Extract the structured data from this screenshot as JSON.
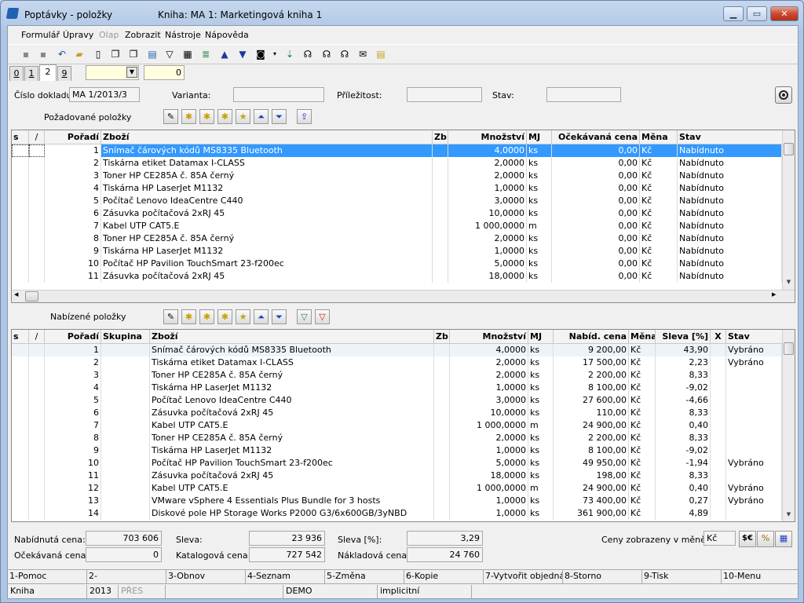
{
  "window": {
    "title": "Poptávky - položky",
    "subtitle": "Kniha: MA 1: Marketingová kniha 1"
  },
  "menu": [
    "Formulář",
    "Úpravy",
    "Olap",
    "Zobrazit",
    "Nástroje",
    "Nápověda"
  ],
  "tabs": [
    "0",
    "1",
    "2",
    "9"
  ],
  "tab_filter": {
    "value": "",
    "counter": "0"
  },
  "header": {
    "cislo_label": "Číslo dokladu:",
    "cislo_value": "MA 1/2013/3",
    "varianta_label": "Varianta:",
    "varianta_value": "",
    "prilezitost_label": "Příležitost:",
    "prilezitost_value": "",
    "stav_label": "Stav:",
    "stav_value": ""
  },
  "requested": {
    "title": "Požadované položky",
    "columns": [
      "s",
      "/",
      "Pořadí",
      "Zboží",
      "Zb",
      "Množství",
      "MJ",
      "Očekávaná cena",
      "Měna",
      "Stav"
    ],
    "rows": [
      {
        "poradi": "1",
        "zbozi": "Snímač čárových kódů MS8335 Bluetooth",
        "mnozstvi": "4,0000",
        "mj": "ks",
        "cena": "0,00",
        "mena": "Kč",
        "stav": "Nabídnuto"
      },
      {
        "poradi": "2",
        "zbozi": "Tiskárna etiket Datamax I-CLASS",
        "mnozstvi": "2,0000",
        "mj": "ks",
        "cena": "0,00",
        "mena": "Kč",
        "stav": "Nabídnuto"
      },
      {
        "poradi": "3",
        "zbozi": "Toner HP CE285A č. 85A černý",
        "mnozstvi": "2,0000",
        "mj": "ks",
        "cena": "0,00",
        "mena": "Kč",
        "stav": "Nabídnuto"
      },
      {
        "poradi": "4",
        "zbozi": "Tiskárna HP LaserJet M1132",
        "mnozstvi": "1,0000",
        "mj": "ks",
        "cena": "0,00",
        "mena": "Kč",
        "stav": "Nabídnuto"
      },
      {
        "poradi": "5",
        "zbozi": "Počítač Lenovo IdeaCentre C440",
        "mnozstvi": "3,0000",
        "mj": "ks",
        "cena": "0,00",
        "mena": "Kč",
        "stav": "Nabídnuto"
      },
      {
        "poradi": "6",
        "zbozi": "Zásuvka počítačová 2xRJ 45",
        "mnozstvi": "10,0000",
        "mj": "ks",
        "cena": "0,00",
        "mena": "Kč",
        "stav": "Nabídnuto"
      },
      {
        "poradi": "7",
        "zbozi": "Kabel UTP CAT5.E",
        "mnozstvi": "1 000,0000",
        "mj": "m",
        "cena": "0,00",
        "mena": "Kč",
        "stav": "Nabídnuto"
      },
      {
        "poradi": "8",
        "zbozi": "Toner HP CE285A č. 85A černý",
        "mnozstvi": "2,0000",
        "mj": "ks",
        "cena": "0,00",
        "mena": "Kč",
        "stav": "Nabídnuto"
      },
      {
        "poradi": "9",
        "zbozi": "Tiskárna HP LaserJet M1132",
        "mnozstvi": "1,0000",
        "mj": "ks",
        "cena": "0,00",
        "mena": "Kč",
        "stav": "Nabídnuto"
      },
      {
        "poradi": "10",
        "zbozi": "Počítač HP Pavilion TouchSmart 23-f200ec",
        "mnozstvi": "5,0000",
        "mj": "ks",
        "cena": "0,00",
        "mena": "Kč",
        "stav": "Nabídnuto"
      },
      {
        "poradi": "11",
        "zbozi": "Zásuvka počítačová 2xRJ 45",
        "mnozstvi": "18,0000",
        "mj": "ks",
        "cena": "0,00",
        "mena": "Kč",
        "stav": "Nabídnuto"
      }
    ]
  },
  "offered": {
    "title": "Nabízené položky",
    "columns": [
      "s",
      "/",
      "Pořadí",
      "Skupina",
      "Zboží",
      "Zb",
      "Množství",
      "MJ",
      "Nabíd. cena",
      "Měna",
      "Sleva [%]",
      "X",
      "Stav"
    ],
    "rows": [
      {
        "poradi": "1",
        "zbozi": "Snímač čárových kódů MS8335 Bluetooth",
        "mnozstvi": "4,0000",
        "mj": "ks",
        "cena": "9 200,00",
        "mena": "Kč",
        "sleva": "43,90",
        "stav": "Vybráno"
      },
      {
        "poradi": "2",
        "zbozi": "Tiskárna etiket Datamax I-CLASS",
        "mnozstvi": "2,0000",
        "mj": "ks",
        "cena": "17 500,00",
        "mena": "Kč",
        "sleva": "2,23",
        "stav": "Vybráno"
      },
      {
        "poradi": "3",
        "zbozi": "Toner HP CE285A č. 85A černý",
        "mnozstvi": "2,0000",
        "mj": "ks",
        "cena": "2 200,00",
        "mena": "Kč",
        "sleva": "8,33",
        "stav": ""
      },
      {
        "poradi": "4",
        "zbozi": "Tiskárna HP LaserJet M1132",
        "mnozstvi": "1,0000",
        "mj": "ks",
        "cena": "8 100,00",
        "mena": "Kč",
        "sleva": "-9,02",
        "stav": ""
      },
      {
        "poradi": "5",
        "zbozi": "Počítač Lenovo IdeaCentre C440",
        "mnozstvi": "3,0000",
        "mj": "ks",
        "cena": "27 600,00",
        "mena": "Kč",
        "sleva": "-4,66",
        "stav": ""
      },
      {
        "poradi": "6",
        "zbozi": "Zásuvka počítačová 2xRJ 45",
        "mnozstvi": "10,0000",
        "mj": "ks",
        "cena": "110,00",
        "mena": "Kč",
        "sleva": "8,33",
        "stav": ""
      },
      {
        "poradi": "7",
        "zbozi": "Kabel UTP CAT5.E",
        "mnozstvi": "1 000,0000",
        "mj": "m",
        "cena": "24 900,00",
        "mena": "Kč",
        "sleva": "0,40",
        "stav": ""
      },
      {
        "poradi": "8",
        "zbozi": "Toner HP CE285A č. 85A černý",
        "mnozstvi": "2,0000",
        "mj": "ks",
        "cena": "2 200,00",
        "mena": "Kč",
        "sleva": "8,33",
        "stav": ""
      },
      {
        "poradi": "9",
        "zbozi": "Tiskárna HP LaserJet M1132",
        "mnozstvi": "1,0000",
        "mj": "ks",
        "cena": "8 100,00",
        "mena": "Kč",
        "sleva": "-9,02",
        "stav": ""
      },
      {
        "poradi": "10",
        "zbozi": "Počítač HP Pavilion TouchSmart 23-f200ec",
        "mnozstvi": "5,0000",
        "mj": "ks",
        "cena": "49 950,00",
        "mena": "Kč",
        "sleva": "-1,94",
        "stav": "Vybráno"
      },
      {
        "poradi": "11",
        "zbozi": "Zásuvka počítačová 2xRJ 45",
        "mnozstvi": "18,0000",
        "mj": "ks",
        "cena": "198,00",
        "mena": "Kč",
        "sleva": "8,33",
        "stav": ""
      },
      {
        "poradi": "12",
        "zbozi": "Kabel UTP CAT5.E",
        "mnozstvi": "1 000,0000",
        "mj": "m",
        "cena": "24 900,00",
        "mena": "Kč",
        "sleva": "0,40",
        "stav": "Vybráno"
      },
      {
        "poradi": "13",
        "zbozi": "VMware vSphere 4 Essentials Plus Bundle for 3 hosts",
        "mnozstvi": "1,0000",
        "mj": "ks",
        "cena": "73 400,00",
        "mena": "Kč",
        "sleva": "0,27",
        "stav": "Vybráno"
      },
      {
        "poradi": "14",
        "zbozi": "Diskové pole HP Storage Works P2000 G3/6x600GB/3yNBD",
        "mnozstvi": "1,0000",
        "mj": "ks",
        "cena": "361 900,00",
        "mena": "Kč",
        "sleva": "4,89",
        "stav": ""
      }
    ]
  },
  "summary": {
    "nabidnuta_label": "Nabídnutá cena:",
    "nabidnuta_value": "703 606",
    "sleva_label": "Sleva:",
    "sleva_value": "23 936",
    "sleva_pct_label": "Sleva [%]:",
    "sleva_pct_value": "3,29",
    "ceny_label": "Ceny zobrazeny v měně:",
    "ceny_value": "Kč",
    "ocekavana_label": "Očekávaná cena:",
    "ocekavana_value": "0",
    "katalogova_label": "Katalogová cena:",
    "katalogova_value": "727 542",
    "nakladova_label": "Nákladová cena:",
    "nakladova_value": "24 760"
  },
  "fkeys": [
    "1-Pomoc",
    "2-",
    "3-Obnov",
    "4-Seznam",
    "5-Změna",
    "6-Kopie",
    "7-Vytvořit objednáv",
    "8-Storno",
    "9-Tisk",
    "10-Menu"
  ],
  "status": [
    "Kniha",
    "2013",
    "PŘES",
    "",
    "DEMO",
    "implicitní"
  ],
  "colors": {
    "selection": "#3399ff",
    "window_frame": "#aec6e4"
  }
}
